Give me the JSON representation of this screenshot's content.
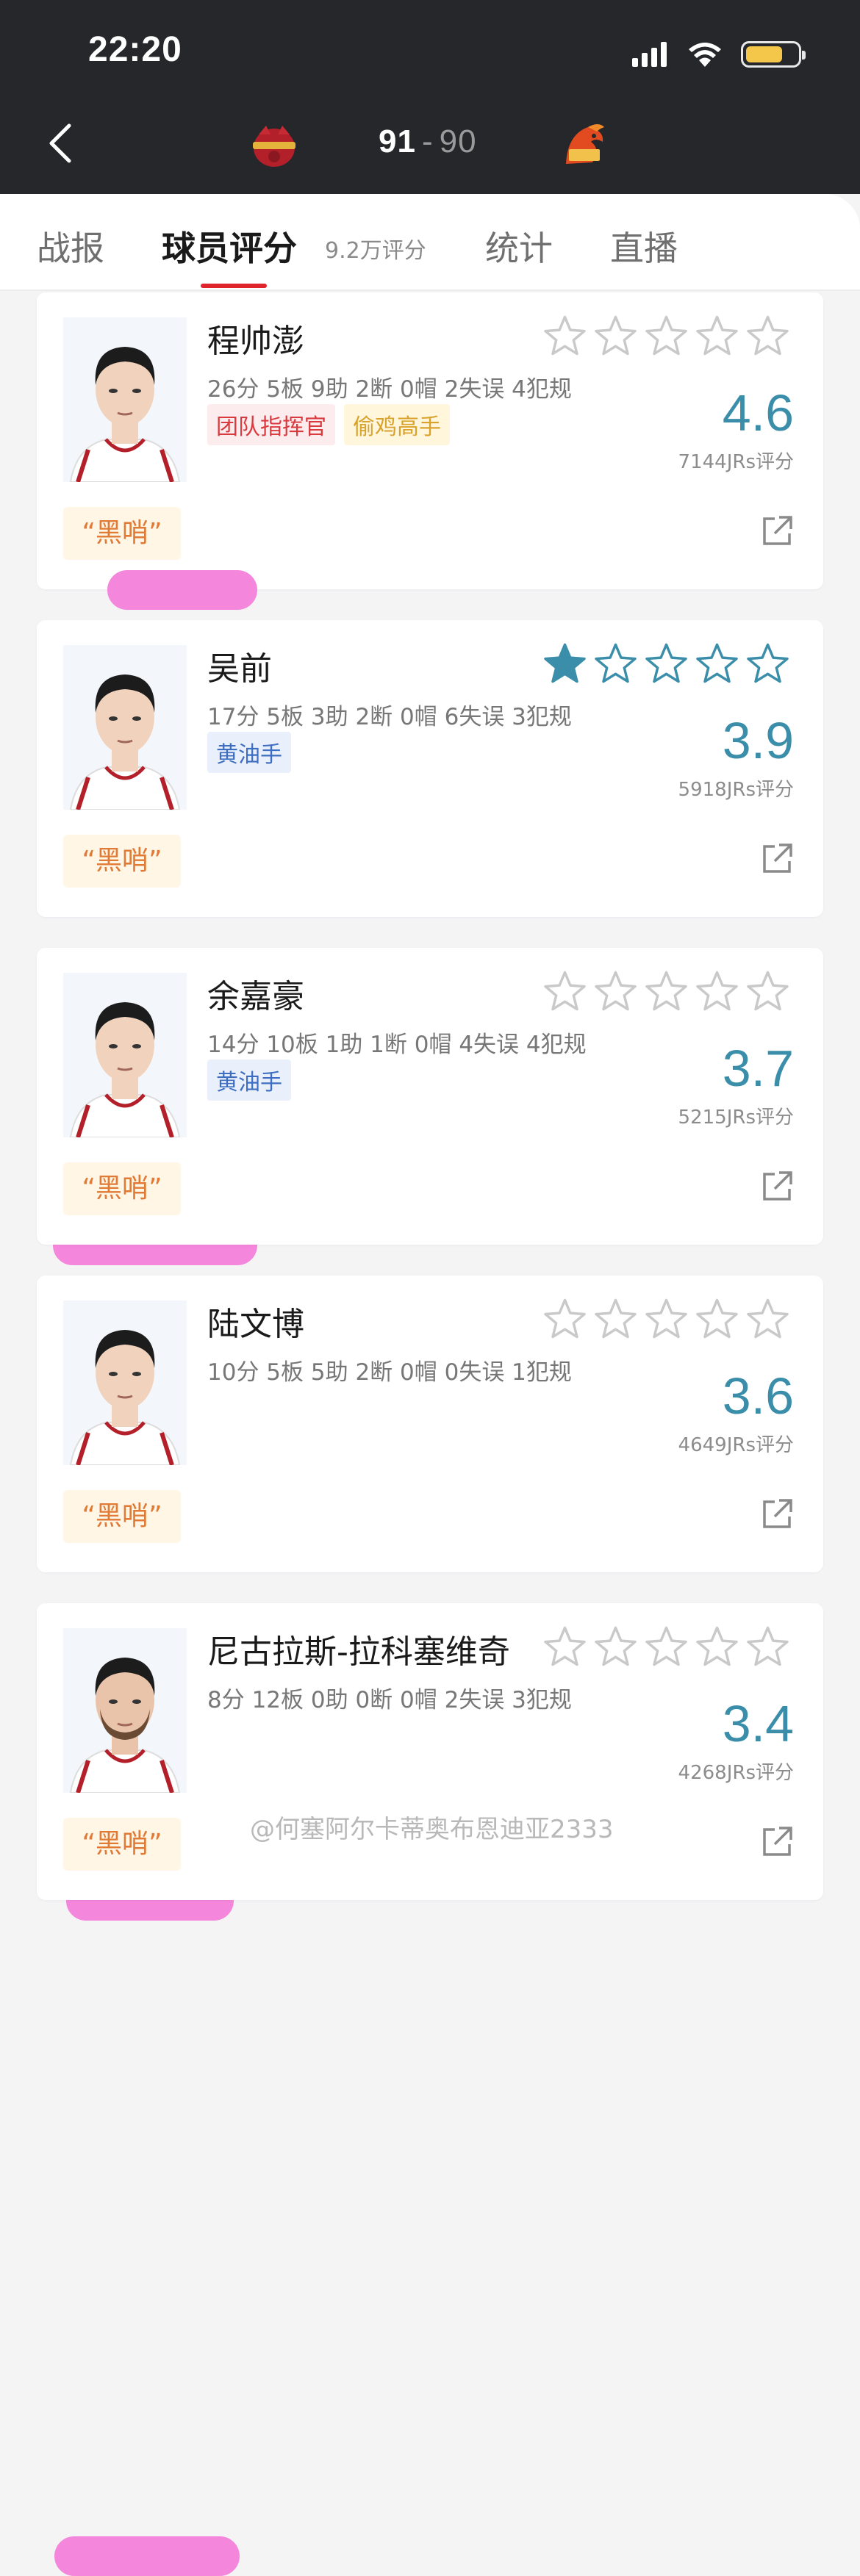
{
  "status_bar": {
    "time": "22:20",
    "battery_level": 0.7
  },
  "header": {
    "home_score": "91",
    "separator": "-",
    "away_score": "90",
    "icons": [
      "back-chevron-icon",
      "home-team-logo",
      "away-team-logo"
    ]
  },
  "tabs": [
    {
      "label": "战报",
      "active": false
    },
    {
      "label": "球员评分",
      "active": true,
      "sub": "9.2万评分"
    },
    {
      "label": "统计",
      "active": false
    },
    {
      "label": "直播",
      "active": false
    }
  ],
  "players": [
    {
      "name": "程帅澎",
      "stats": "26分 5板 9助 2断 0帽 2失误 4犯规",
      "tags": [
        {
          "label": "团队指挥官",
          "style": "red"
        },
        {
          "label": "偷鸡高手",
          "style": "yellow"
        }
      ],
      "rating": "4.6",
      "rating_count": "7144JRs评分",
      "whistle": "“黑哨”",
      "user_stars": 0
    },
    {
      "name": "吴前",
      "stats": "17分 5板 3助 2断 0帽 6失误 3犯规",
      "tags": [
        {
          "label": "黄油手",
          "style": "blue"
        }
      ],
      "rating": "3.9",
      "rating_count": "5918JRs评分",
      "whistle": "“黑哨”",
      "user_stars": 1
    },
    {
      "name": "余嘉豪",
      "stats": "14分 10板 1助 1断 0帽 4失误 4犯规",
      "tags": [
        {
          "label": "黄油手",
          "style": "blue"
        }
      ],
      "rating": "3.7",
      "rating_count": "5215JRs评分",
      "whistle": "“黑哨”",
      "user_stars": 0
    },
    {
      "name": "陆文博",
      "stats": "10分 5板 5助 2断 0帽 0失误 1犯规",
      "tags": [],
      "rating": "3.6",
      "rating_count": "4649JRs评分",
      "whistle": "“黑哨”",
      "user_stars": 0
    },
    {
      "name": "尼古拉斯-拉科塞维奇",
      "stats": "8分 12板 0助 0断 0帽 2失误 3犯规",
      "tags": [],
      "rating": "3.4",
      "rating_count": "4268JRs评分",
      "whistle": "“黑哨”",
      "user_stars": 0
    }
  ],
  "watermark": "@何塞阿尔卡蒂奥布恩迪亚2333",
  "colors": {
    "header_bg": "#26272b",
    "accent_red": "#e0242c",
    "rating_teal": "#3b8ea9",
    "whistle_orange": "#e07a35",
    "highlight_pink": "#f37fda"
  }
}
